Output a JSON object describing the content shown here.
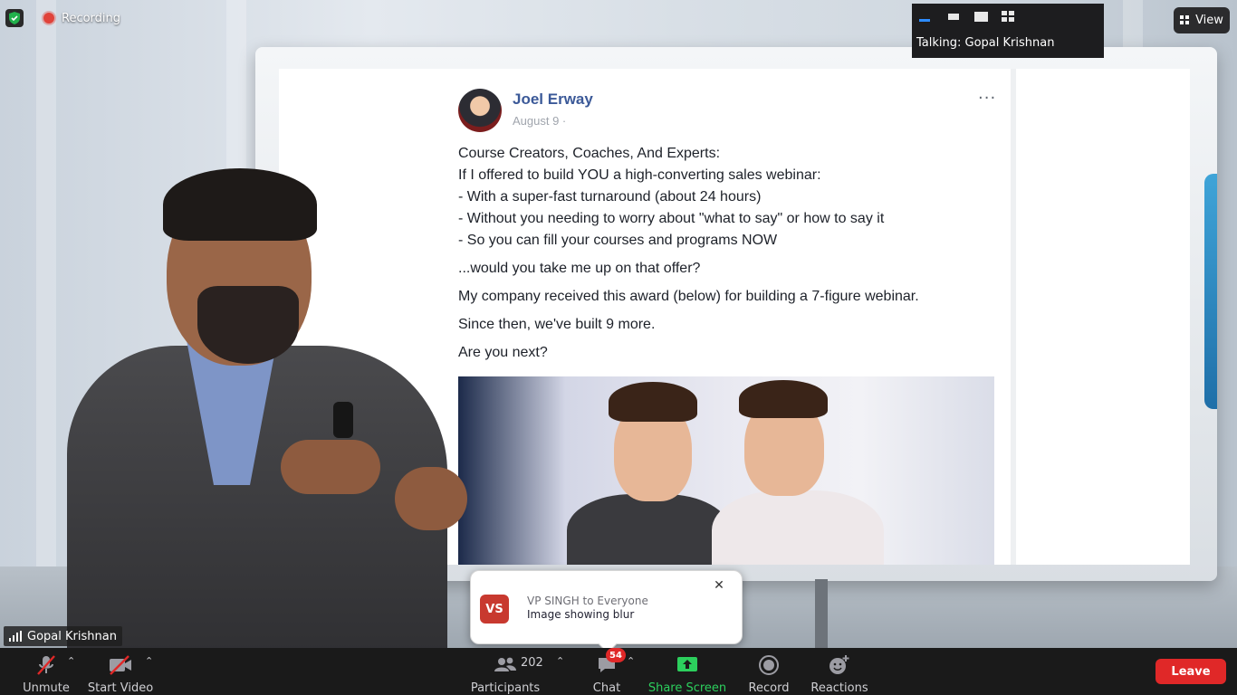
{
  "recording": {
    "label": "Recording"
  },
  "talking": {
    "prefix": "Talking:",
    "name": "Gopal Krishnan",
    "text": "Talking: Gopal Krishnan"
  },
  "view_button": {
    "label": "View"
  },
  "presenter": {
    "name": "Gopal Krishnan"
  },
  "shared_post": {
    "author": "Joel Erway",
    "date": "August 9 ·",
    "more": "···",
    "intro": "Course Creators, Coaches, And Experts:",
    "lines": [
      "If I offered to build YOU a high-converting sales webinar:",
      "- With a super-fast turnaround (about 24 hours)",
      "- Without you needing to worry about \"what to say\" or how to say it",
      "- So you can fill your courses and programs NOW"
    ],
    "question": "...would you take me up on that offer?",
    "award": "My company received this award (below) for building a 7-figure webinar.",
    "since": "Since then, we've built 9 more.",
    "cta": "Are you next?"
  },
  "chat_toast": {
    "initials": "VS",
    "from": "VP SINGH to Everyone",
    "message": "Image showing blur",
    "close": "✕"
  },
  "toolbar": {
    "unmute": "Unmute",
    "start_video": "Start Video",
    "participants": "Participants",
    "participants_count": "202",
    "chat": "Chat",
    "chat_badge": "54",
    "share_screen": "Share Screen",
    "record": "Record",
    "reactions": "Reactions",
    "leave": "Leave"
  },
  "colors": {
    "toolbar_bg": "#1a1a1a",
    "leave_red": "#e02828",
    "share_green": "#2ccf5d",
    "security_green": "#22b14c",
    "author_blue": "#3b5998"
  },
  "icons": [
    "shield-icon",
    "record-dot-icon",
    "speaker-view-icon",
    "gallery-view-icon",
    "microphone-muted-icon",
    "video-muted-icon",
    "participants-icon",
    "chat-icon",
    "share-screen-icon",
    "record-icon",
    "reactions-icon",
    "signal-icon",
    "close-icon"
  ]
}
